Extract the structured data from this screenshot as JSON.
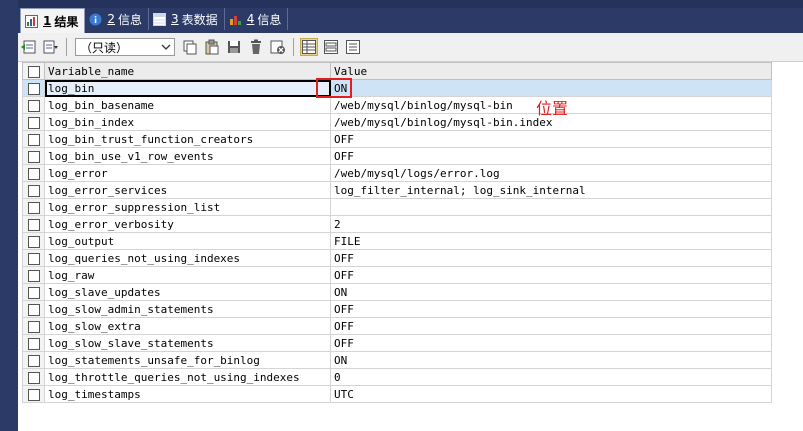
{
  "tabs": [
    {
      "num": "1",
      "label": "结果",
      "icon": "result-grid-icon",
      "active": true
    },
    {
      "num": "2",
      "label": "信息",
      "icon": "info-icon",
      "active": false
    },
    {
      "num": "3",
      "label": "表数据",
      "icon": "table-data-icon",
      "active": false
    },
    {
      "num": "4",
      "label": "信息",
      "icon": "info-chart-icon",
      "active": false
    }
  ],
  "toolbar": {
    "mode_select_value": "（只读）",
    "icons": [
      "export-icon",
      "import-dropdown-icon",
      "copy-icon",
      "paste-icon",
      "save-icon",
      "delete-icon",
      "cancel-icon",
      "grid-view-icon",
      "form-view-icon",
      "text-view-icon"
    ]
  },
  "grid": {
    "columns": [
      "Variable_name",
      "Value"
    ],
    "rows": [
      [
        "log_bin",
        "ON"
      ],
      [
        "log_bin_basename",
        "/web/mysql/binlog/mysql-bin"
      ],
      [
        "log_bin_index",
        "/web/mysql/binlog/mysql-bin.index"
      ],
      [
        "log_bin_trust_function_creators",
        "OFF"
      ],
      [
        "log_bin_use_v1_row_events",
        "OFF"
      ],
      [
        "log_error",
        "/web/mysql/logs/error.log"
      ],
      [
        "log_error_services",
        "log_filter_internal; log_sink_internal"
      ],
      [
        "log_error_suppression_list",
        ""
      ],
      [
        "log_error_verbosity",
        "2"
      ],
      [
        "log_output",
        "FILE"
      ],
      [
        "log_queries_not_using_indexes",
        "OFF"
      ],
      [
        "log_raw",
        "OFF"
      ],
      [
        "log_slave_updates",
        "ON"
      ],
      [
        "log_slow_admin_statements",
        "OFF"
      ],
      [
        "log_slow_extra",
        "OFF"
      ],
      [
        "log_slow_slave_statements",
        "OFF"
      ],
      [
        "log_statements_unsafe_for_binlog",
        "ON"
      ],
      [
        "log_throttle_queries_not_using_indexes",
        "0"
      ],
      [
        "log_timestamps",
        "UTC"
      ]
    ],
    "selected_row": 0
  },
  "annotation": {
    "text": "位置",
    "color": "#e02020"
  },
  "colors": {
    "frame": "#2b3a67",
    "selection": "#cfe3f7",
    "annotation": "#e02020"
  }
}
